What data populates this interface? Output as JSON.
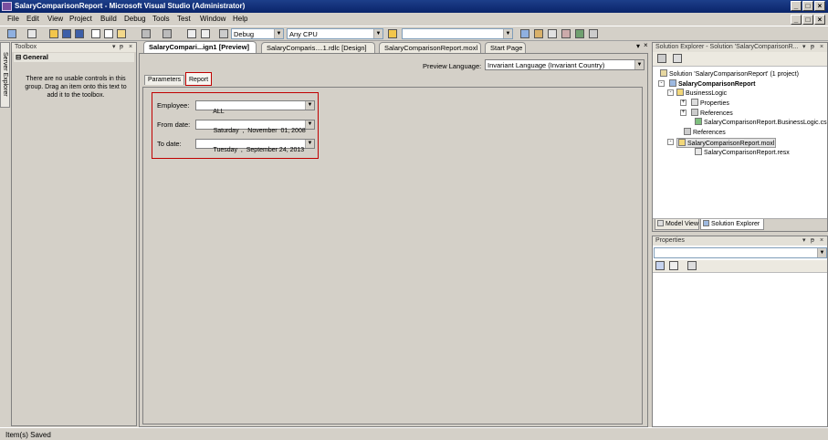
{
  "window": {
    "title": "SalaryComparisonReport - Microsoft Visual Studio (Administrator)"
  },
  "menu": [
    "File",
    "Edit",
    "View",
    "Project",
    "Build",
    "Debug",
    "Tools",
    "Test",
    "Window",
    "Help"
  ],
  "toolbar": {
    "config": "Debug",
    "platform": "Any CPU",
    "find": ""
  },
  "side_tab": "Server Explorer",
  "toolbox": {
    "title": "Toolbox",
    "section": "General",
    "message": "There are no usable controls in this group. Drag an item onto this text to add it to the toolbox."
  },
  "doc_tabs": [
    "SalaryCompari...ign1 [Preview]",
    "SalaryComparis....1.rdlc [Design]",
    "SalaryComparisonReport.moxl",
    "Start Page"
  ],
  "preview": {
    "language_label": "Preview Language:",
    "language_value": "Invariant Language (Invariant Country)",
    "subtabs": [
      "Parameters",
      "Report"
    ],
    "params": {
      "employee_label": "Employee:",
      "employee_value": "ALL",
      "from_label": "From date:",
      "from_value": "Saturday  ,  November  01, 2008",
      "to_label": "To date:",
      "to_value": "Tuesday  ,  September 24, 2013"
    }
  },
  "solution_explorer": {
    "title": "Solution Explorer - Solution 'SalaryComparisonR...",
    "items": [
      "Solution 'SalaryComparisonReport' (1 project)",
      "SalaryComparisonReport",
      "BusinessLogic",
      "Properties",
      "References",
      "SalaryComparisonReport.BusinessLogic.cs",
      "References",
      "SalaryComparisonReport.moxl",
      "SalaryComparisonReport.resx"
    ],
    "bottom_tabs": [
      "Model View",
      "Solution Explorer"
    ]
  },
  "properties": {
    "title": "Properties"
  },
  "status": "Item(s) Saved",
  "colors": {
    "highlight_red": "#c00000",
    "titlebar": "#0a246a"
  }
}
